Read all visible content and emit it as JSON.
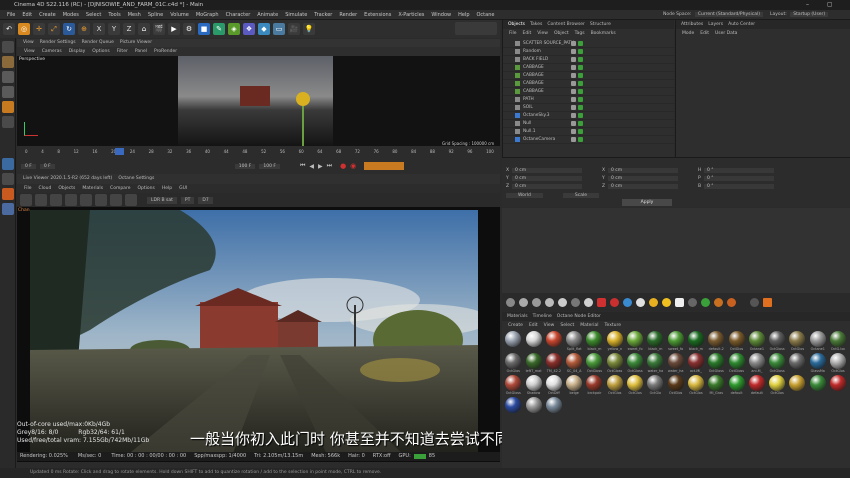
{
  "app": {
    "title": "Cinema 4D S22.116 (RC) - [DJNISOWIE_AND_FARM_01C.c4d *] - Main"
  },
  "menus": [
    "File",
    "Edit",
    "Create",
    "Modes",
    "Select",
    "Tools",
    "Mesh",
    "Spline",
    "Volume",
    "MoGraph",
    "Character",
    "Animate",
    "Simulate",
    "Tracker",
    "Render",
    "Extensions",
    "X-Particles",
    "Window",
    "Help",
    "Octane"
  ],
  "node_space": {
    "label": "Node Space:",
    "value": "Current (Standard/Physical)"
  },
  "layout": {
    "label": "Layout:",
    "value": "Startup (User)"
  },
  "viewport1": {
    "tabs": [
      "View",
      "Render Settings",
      "Render Queue",
      "Picture Viewer"
    ],
    "menu": [
      "View",
      "Cameras",
      "Display",
      "Options",
      "Filter",
      "Panel",
      "ProRender"
    ],
    "label": "Perspective",
    "grid": "Grid Spacing : 100000 cm"
  },
  "timeline": {
    "ticks": [
      "0",
      "4",
      "8",
      "12",
      "16",
      "20",
      "24",
      "28",
      "32",
      "36",
      "40",
      "44",
      "48",
      "52",
      "56",
      "60",
      "64",
      "68",
      "72",
      "76",
      "80",
      "84",
      "88",
      "92",
      "96",
      "100"
    ],
    "start": "0 F",
    "cur": "0 F",
    "end": "100 F",
    "end2": "100 F",
    "frame": "0 F"
  },
  "liveviewer": {
    "title": "Live Viewer 2020.1.5-R2 (652 days left)",
    "tab2": "Octane Settings",
    "menu": [
      "File",
      "Cloud",
      "Objects",
      "Materials",
      "Compare",
      "Options",
      "Help",
      "GUI"
    ],
    "mode": "LDR B sat",
    "mode2": "PT",
    "val": "D7",
    "channel": "Chan"
  },
  "stats": {
    "line1": "Out-of-core used/max:0Kb/4Gb",
    "line2a": "Grey8/16: 8/0",
    "line2b": "Rgb32/64: 61/1",
    "line3": "Used/free/total vram: 7.155Gb/742Mb/11Gb"
  },
  "renderbar": {
    "rendering": "Rendering: 0.025%",
    "ms": "Ms/sec: 0",
    "time": "Time: 00 : 00 : 00/00 : 00 : 00",
    "spp": "Spp/maxspp: 1/4000",
    "tri": "Tri: 2.105m/13.15m",
    "mesh": "Mesh: 566k",
    "hair": "Hair: 0",
    "rtx": "RTX:off",
    "gpu": "GPU:",
    "gpuval": "85"
  },
  "subtitle": "一般当你初入此门时  你甚至并不知道去尝试不同的焦距",
  "objects": {
    "tabs": [
      "Objects",
      "Takes",
      "Content Browser",
      "Structure"
    ],
    "menu": [
      "File",
      "Edit",
      "View",
      "Object",
      "Tags",
      "Bookmarks"
    ],
    "rows": [
      "SCATTER SOURCE_PATH",
      "Random",
      "BACK FIELD",
      "CABBAGE",
      "CABBAGE",
      "CABBAGE",
      "CABBAGE",
      "PATH",
      "SOIL",
      "OctaneSky.3",
      "Null",
      "Null.1",
      "OctaneCamera"
    ]
  },
  "attributes": {
    "tabs": [
      "Attributes",
      "Layers",
      "Auto Center"
    ],
    "menu": [
      "Mode",
      "Edit",
      "User Data"
    ]
  },
  "coords": {
    "rows": [
      [
        "X",
        "0 cm",
        "X",
        "0 cm",
        "H",
        "0 °"
      ],
      [
        "Y",
        "0 cm",
        "Y",
        "0 cm",
        "P",
        "0 °"
      ],
      [
        "Z",
        "0 cm",
        "Z",
        "0 cm",
        "B",
        "0 °"
      ]
    ],
    "sel1": "World",
    "sel2": "Scale",
    "apply": "Apply"
  },
  "materials": {
    "tabs": [
      "Materials",
      "Timeline",
      "Octane Node Editor"
    ],
    "menu": [
      "Create",
      "Edit",
      "View",
      "Select",
      "Material",
      "Texture"
    ],
    "items": [
      {
        "n": "",
        "c": "#9aa3b0"
      },
      {
        "n": "",
        "c": "#d6d6d6"
      },
      {
        "n": "",
        "c": "#c8462e"
      },
      {
        "n": "Split_flat",
        "c": "#8a8a8a"
      },
      {
        "n": "black_m",
        "c": "#3c8a2c"
      },
      {
        "n": "yellow_n",
        "c": "#d8b12a"
      },
      {
        "n": "sweet_fo",
        "c": "#6aa83a"
      },
      {
        "n": "black_m",
        "c": "#2a6b2a"
      },
      {
        "n": "sweet_fo",
        "c": "#4c9a34"
      },
      {
        "n": "black_m",
        "c": "#1a6b20"
      },
      {
        "n": "default.2",
        "c": "#7a5b30"
      },
      {
        "n": "OctGlos",
        "c": "#7a5a2a"
      },
      {
        "n": "Octane1",
        "c": "#5d8a38"
      },
      {
        "n": "OctGloss",
        "c": "#5e5e5e"
      },
      {
        "n": "OctGlos",
        "c": "#8a7a4a"
      },
      {
        "n": "Octane1",
        "c": "#9a9a9a"
      },
      {
        "n": "OctG.loc",
        "c": "#4a7a38"
      },
      {
        "n": "OctGlos",
        "c": "#6a6a6a"
      },
      {
        "n": "leftT_mat",
        "c": "#3a6a2a"
      },
      {
        "n": "TM_42.2",
        "c": "#8a2e2a"
      },
      {
        "n": "SC_04_A",
        "c": "#b25a3a"
      },
      {
        "n": "OctGloss",
        "c": "#4a9a3a"
      },
      {
        "n": "OctGloss",
        "c": "#7a8a3a"
      },
      {
        "n": "OctGloss",
        "c": "#3c8a3a"
      },
      {
        "n": "water_ha",
        "c": "#3a7a3a"
      },
      {
        "n": "water_ha",
        "c": "#6a4a3a"
      },
      {
        "n": "oct-Mi_",
        "c": "#8a3030"
      },
      {
        "n": "OctGloss",
        "c": "#2a7a2a"
      },
      {
        "n": "OctGloss",
        "c": "#2e8a30"
      },
      {
        "n": "ani.M_",
        "c": "#8a8a8a"
      },
      {
        "n": "OctGloss",
        "c": "#3a8a3a"
      },
      {
        "n": "",
        "c": "#6a6a6a"
      },
      {
        "n": "GlassMa",
        "c": "#2a6a9a"
      },
      {
        "n": "OctGlos",
        "c": "#b0b0b0"
      },
      {
        "n": "OctGloss",
        "c": "#b04a3a"
      },
      {
        "n": "Shadow",
        "c": "#cfcfcf"
      },
      {
        "n": "OctDiff",
        "c": "#e0e0e0"
      },
      {
        "n": "beige",
        "c": "#c8b08a"
      },
      {
        "n": "brckpair",
        "c": "#9a3a2a"
      },
      {
        "n": "OctGlos",
        "c": "#c0a040"
      },
      {
        "n": "OctGlos",
        "c": "#e0c040"
      },
      {
        "n": "OctGlo",
        "c": "#7a7a7a"
      },
      {
        "n": "OctGlos",
        "c": "#5a3a1a"
      },
      {
        "n": "OctGlos",
        "c": "#d8b840"
      },
      {
        "n": "MI_Gras",
        "c": "#3a7a2a"
      },
      {
        "n": "default",
        "c": "#2e9a2e"
      },
      {
        "n": "default",
        "c": "#c02a2a"
      },
      {
        "n": "OctGlos",
        "c": "#e0d040"
      },
      {
        "n": "",
        "c": "#c8a030"
      },
      {
        "n": "",
        "c": "#3a8a3a"
      },
      {
        "n": "",
        "c": "#c02a2a"
      },
      {
        "n": "",
        "c": "#2a4aa0"
      },
      {
        "n": "",
        "c": "#9a9a9a"
      },
      {
        "n": "",
        "c": "#7a8a9a"
      }
    ]
  },
  "status": {
    "text": "Updated 0 ms    Rotate: Click and drag to rotate elements. Hold down SHIFT to add to quantize rotation / add to the selection in point mode, CTRL to remove."
  }
}
